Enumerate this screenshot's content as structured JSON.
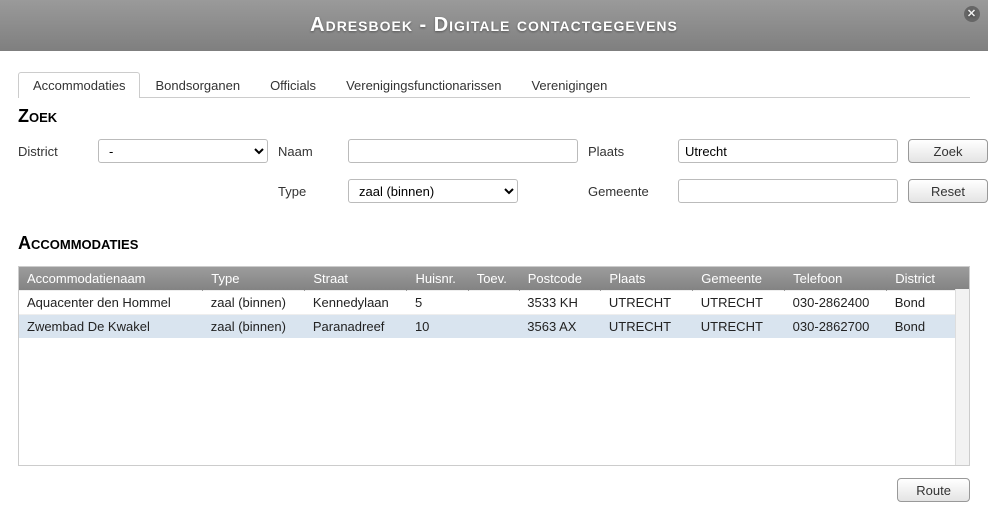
{
  "window": {
    "title": "Adresboek - Digitale contactgegevens"
  },
  "tabs": [
    {
      "label": "Accommodaties",
      "active": true
    },
    {
      "label": "Bondsorganen",
      "active": false
    },
    {
      "label": "Officials",
      "active": false
    },
    {
      "label": "Verenigingsfunctionarissen",
      "active": false
    },
    {
      "label": "Verenigingen",
      "active": false
    }
  ],
  "search": {
    "heading": "Zoek",
    "district_label": "District",
    "district_value": "-",
    "naam_label": "Naam",
    "naam_value": "",
    "type_label": "Type",
    "type_value": "zaal (binnen)",
    "plaats_label": "Plaats",
    "plaats_value": "Utrecht",
    "gemeente_label": "Gemeente",
    "gemeente_value": "",
    "zoek_button": "Zoek",
    "reset_button": "Reset"
  },
  "results": {
    "heading": "Accommodaties",
    "columns": [
      "Accommodatienaam",
      "Type",
      "Straat",
      "Huisnr.",
      "Toev.",
      "Postcode",
      "Plaats",
      "Gemeente",
      "Telefoon",
      "District"
    ],
    "rows": [
      {
        "cells": [
          "Aquacenter den Hommel",
          "zaal (binnen)",
          "Kennedylaan",
          "5",
          "",
          "3533 KH",
          "UTRECHT",
          "UTRECHT",
          "030-2862400",
          "Bond"
        ],
        "selected": false
      },
      {
        "cells": [
          "Zwembad De Kwakel",
          "zaal (binnen)",
          "Paranadreef",
          "10",
          "",
          "3563 AX",
          "UTRECHT",
          "UTRECHT",
          "030-2862700",
          "Bond"
        ],
        "selected": true
      }
    ],
    "route_button": "Route"
  }
}
